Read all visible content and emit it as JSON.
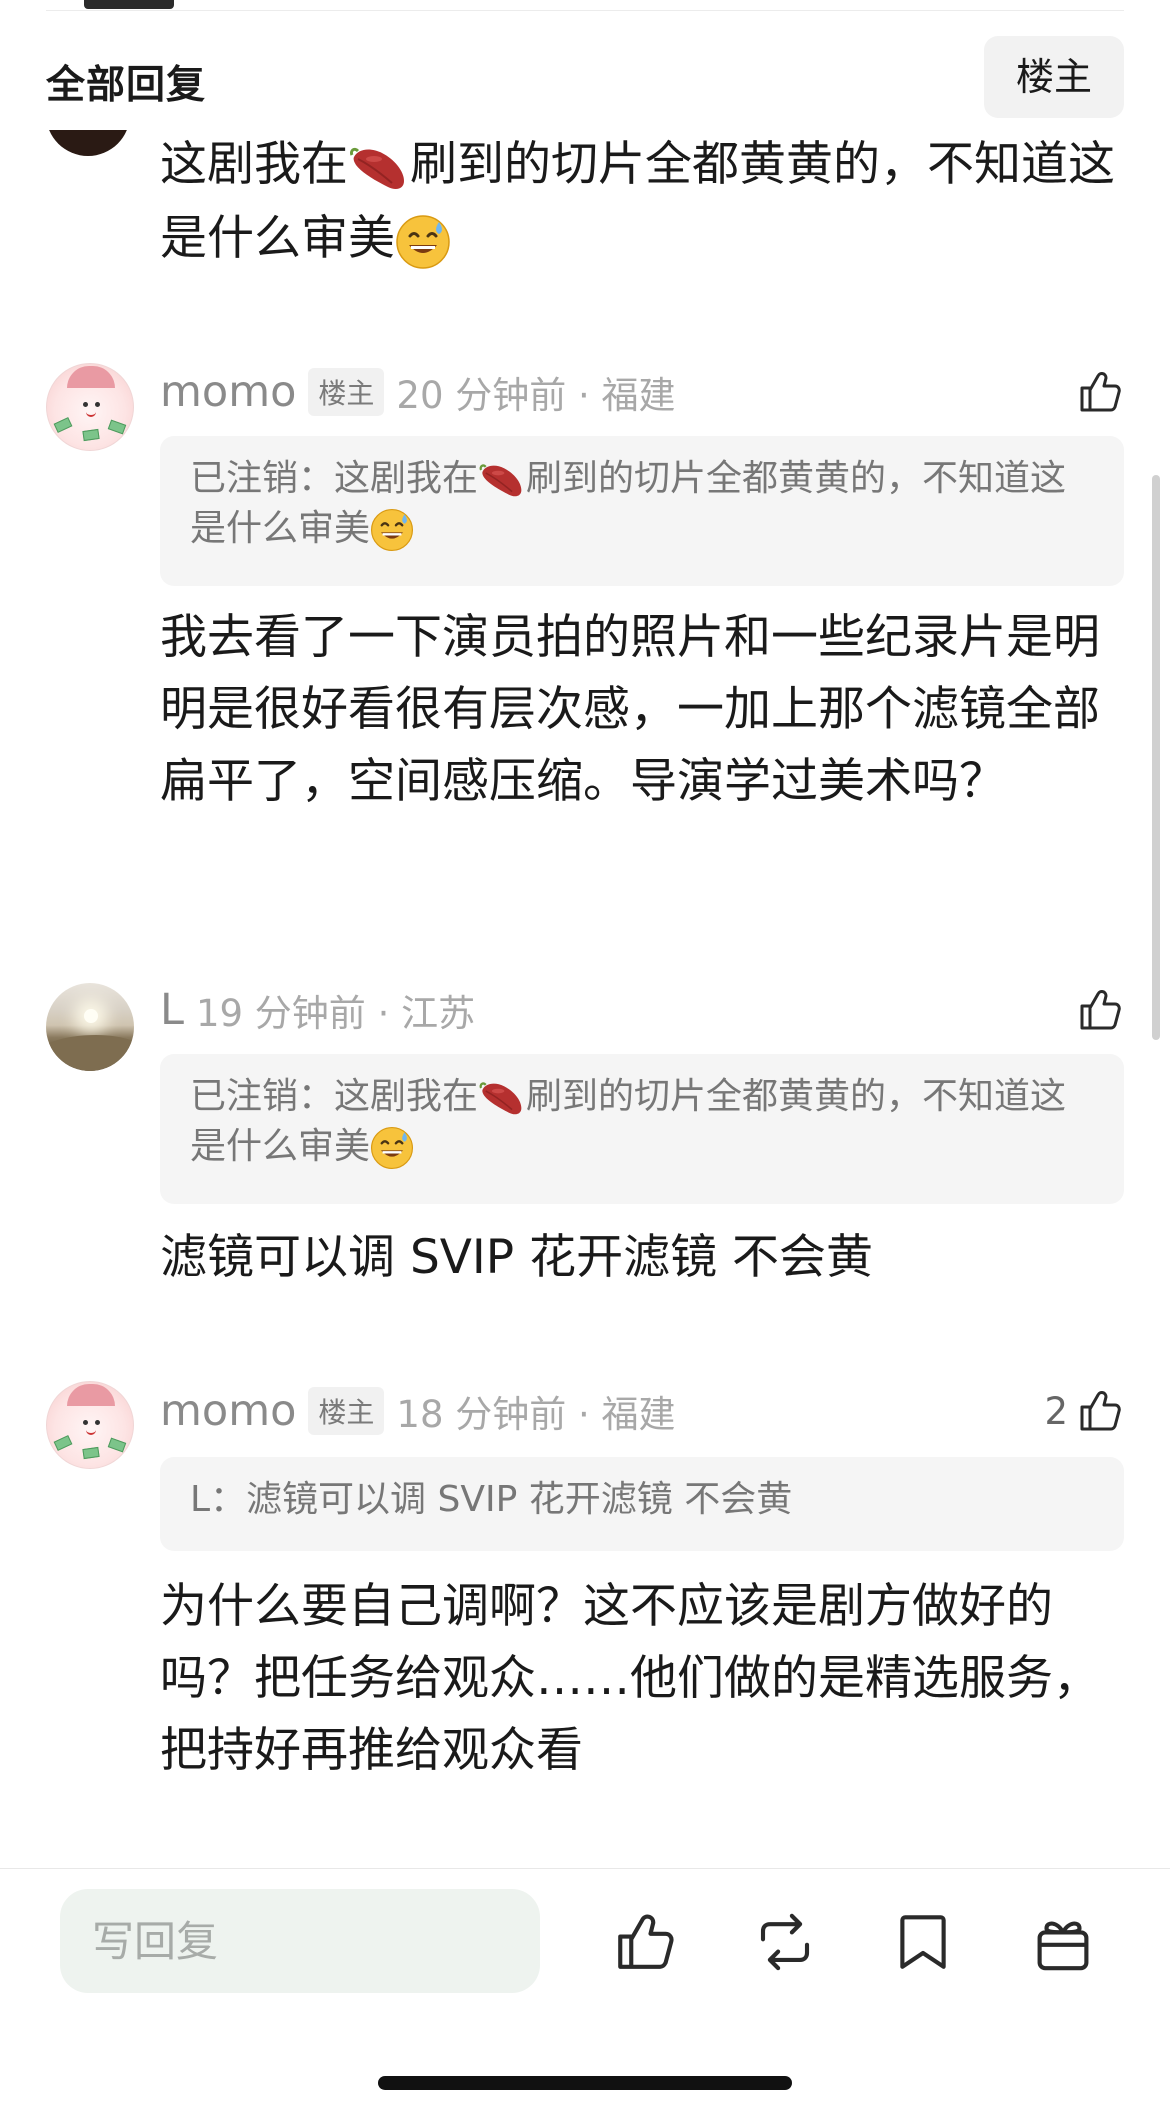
{
  "header": {
    "title": "全部回复",
    "op_filter_label": "楼主"
  },
  "top_reply": {
    "text_part1": "这剧我在",
    "text_part2": "刷到的切片全都黄黄的，不知道这是什么审美"
  },
  "comments": [
    {
      "username": "momo",
      "badge": "楼主",
      "time_location": "20 分钟前 · 福建",
      "like_count": "",
      "quote_prefix": "已注销：这剧我在",
      "quote_suffix": "刷到的切片全都黄黄的，不知道这是什么审美",
      "body": "我去看了一下演员拍的照片和一些纪录片是明明是很好看很有层次感，一加上那个滤镜全部扁平了，空间感压缩。导演学过美术吗？"
    },
    {
      "username": "L",
      "badge": "",
      "time_location": "19 分钟前 · 江苏",
      "like_count": "",
      "quote_prefix": "已注销：这剧我在",
      "quote_suffix": "刷到的切片全都黄黄的，不知道这是什么审美",
      "body": "滤镜可以调 SVIP 花开滤镜 不会黄"
    },
    {
      "username": "momo",
      "badge": "楼主",
      "time_location": "18 分钟前 · 福建",
      "like_count": "2",
      "quote_text": "L：滤镜可以调 SVIP 花开滤镜 不会黄",
      "body": "为什么要自己调啊？这不应该是剧方做好的吗？把任务给观众……他们做的是精选服务，把持好再推给观众看"
    }
  ],
  "bottom_bar": {
    "reply_placeholder": "写回复",
    "icons": [
      "like-icon",
      "repost-icon",
      "bookmark-icon",
      "gift-icon"
    ]
  },
  "colors": {
    "accent_input_bg": "#eef3ef",
    "meta_gray": "#a8a8a8",
    "quote_bg": "#f5f5f5"
  }
}
